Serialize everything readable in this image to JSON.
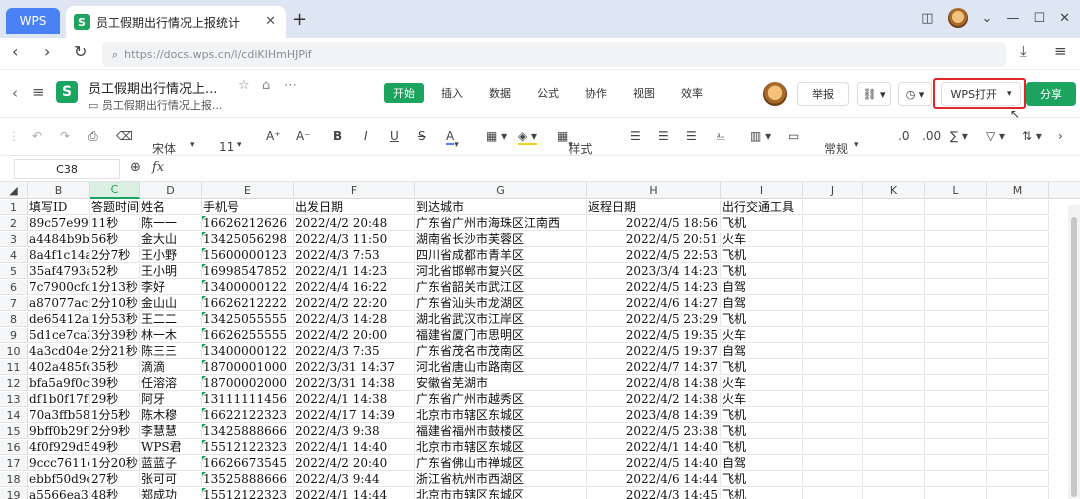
{
  "tabs": {
    "wps": "WPS",
    "doc_title": "员工假期出行情况上报统计"
  },
  "address": {
    "url": "https://docs.wps.cn/l/cdiKIHmHJPif"
  },
  "header": {
    "title": "员工假期出行情况上...",
    "subtitle": "员工假期出行情况上报...",
    "menus": [
      "开始",
      "插入",
      "数据",
      "公式",
      "协作",
      "视图",
      "效率"
    ],
    "report_btn": "举报",
    "open_btn": "WPS打开",
    "share_btn": "分享"
  },
  "toolbar": {
    "font": "宋体",
    "size": "11",
    "style_btn": "样式",
    "numfmt": "常规"
  },
  "formula": {
    "cell_ref": "C38",
    "fx": "fx"
  },
  "accent": "#1ca35e",
  "highlight": "#e0262b",
  "columns": [
    "B",
    "C",
    "D",
    "E",
    "F",
    "G",
    "H",
    "I",
    "J",
    "K",
    "L",
    "M"
  ],
  "rows": [
    {
      "n": "1",
      "cells": [
        "填写ID",
        "答题时间",
        "姓名",
        "手机号",
        "出发日期",
        "到达城市",
        "返程日期",
        "出行交通工具"
      ]
    },
    {
      "n": "2",
      "cells": [
        "89c57e99e",
        "11秒",
        "陈一一",
        "16626212626",
        "2022/4/2 20:48",
        "广东省广州市海珠区江南西",
        "2022/4/5 18:56",
        "飞机"
      ]
    },
    {
      "n": "3",
      "cells": [
        "a4484b9b6",
        "56秒",
        "金大山",
        "13425056298",
        "2022/4/3 11:50",
        "湖南省长沙市芙蓉区",
        "2022/4/5 20:51",
        "火车"
      ]
    },
    {
      "n": "4",
      "cells": [
        "8a4f1c14a",
        "2分7秒",
        "王小野",
        "15600000123",
        "2022/4/3 7:53",
        "四川省成都市青羊区",
        "2022/4/5 22:53",
        "飞机"
      ]
    },
    {
      "n": "5",
      "cells": [
        "35af4793a",
        "52秒",
        "王小明",
        "16998547852",
        "2022/4/1 14:23",
        "河北省邯郸市复兴区",
        "2023/3/4 14:23",
        "飞机"
      ]
    },
    {
      "n": "6",
      "cells": [
        "7c7900cfc",
        "1分13秒",
        "李好",
        "13400000122",
        "2022/4/4 16:22",
        "广东省韶关市武江区",
        "2022/4/5 14:23",
        "自驾"
      ]
    },
    {
      "n": "7",
      "cells": [
        "a87077ac8",
        "2分10秒",
        "金山山",
        "16626212222",
        "2022/4/2 22:20",
        "广东省汕头市龙湖区",
        "2022/4/6 14:27",
        "自驾"
      ]
    },
    {
      "n": "8",
      "cells": [
        "de65412a8",
        "1分53秒",
        "王二二",
        "13425055555",
        "2022/4/3 14:28",
        "湖北省武汉市江岸区",
        "2022/4/5 23:29",
        "飞机"
      ]
    },
    {
      "n": "9",
      "cells": [
        "5d1ce7ca3",
        "3分39秒",
        "林一木",
        "16626255555",
        "2022/4/2 20:00",
        "福建省厦门市思明区",
        "2022/4/5 19:35",
        "火车"
      ]
    },
    {
      "n": "10",
      "cells": [
        "4a3cd04e1",
        "2分21秒",
        "陈三三",
        "13400000122",
        "2022/4/3 7:35",
        "广东省茂名市茂南区",
        "2022/4/5 19:37",
        "自驾"
      ]
    },
    {
      "n": "11",
      "cells": [
        "402a485fc",
        "35秒",
        "滴滴",
        "18700001000",
        "2022/3/31 14:37",
        "河北省唐山市路南区",
        "2022/4/7 14:37",
        "飞机"
      ]
    },
    {
      "n": "12",
      "cells": [
        "bfa5a9f0c",
        "39秒",
        "任溶溶",
        "18700002000",
        "2022/3/31 14:38",
        "安徽省芜湖市",
        "2022/4/8 14:38",
        "火车"
      ]
    },
    {
      "n": "13",
      "cells": [
        "df1b0f17f",
        "29秒",
        "阿牙",
        "13111111456",
        "2022/4/1 14:38",
        "广东省广州市越秀区",
        "2022/4/2 14:38",
        "火车"
      ]
    },
    {
      "n": "14",
      "cells": [
        "70a3ffb58",
        "1分5秒",
        "陈木穆",
        "16622122323",
        "2022/4/17 14:39",
        "北京市市辖区东城区",
        "2023/4/8 14:39",
        "飞机"
      ]
    },
    {
      "n": "15",
      "cells": [
        "9bff0b29f",
        "2分9秒",
        "李慧慧",
        "13425888666",
        "2022/4/3 9:38",
        "福建省福州市鼓楼区",
        "2022/4/5 23:38",
        "飞机"
      ]
    },
    {
      "n": "16",
      "cells": [
        "4f0f929d5",
        "49秒",
        "WPS君",
        "15512122323",
        "2022/4/1 14:40",
        "北京市市辖区东城区",
        "2022/4/1 14:40",
        "飞机"
      ]
    },
    {
      "n": "17",
      "cells": [
        "9ccc7611c",
        "1分20秒",
        "蓝蓝子",
        "16626673545",
        "2022/4/2 20:40",
        "广东省佛山市禅城区",
        "2022/4/5 14:40",
        "自驾"
      ]
    },
    {
      "n": "18",
      "cells": [
        "ebbf50d9c",
        "27秒",
        "张可可",
        "13525888666",
        "2022/4/3 9:44",
        "浙江省杭州市西湖区",
        "2022/4/6 14:44",
        "飞机"
      ]
    },
    {
      "n": "19",
      "cells": [
        "a5566ea3f",
        "48秒",
        "郑成功",
        "15512122323",
        "2022/4/1 14:44",
        "北京市市辖区东城区",
        "2022/4/3 14:45",
        "飞机"
      ]
    }
  ]
}
